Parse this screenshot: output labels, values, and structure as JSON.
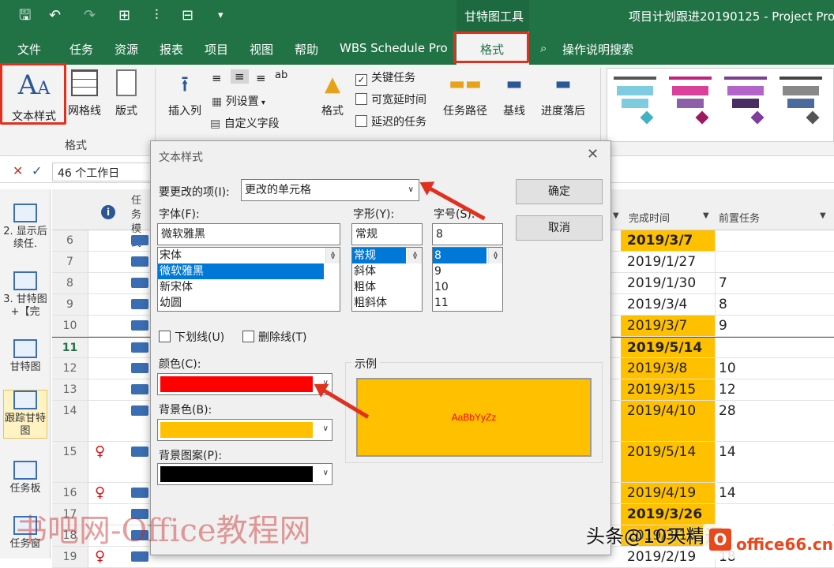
{
  "app": {
    "title": "项目计划跟进20190125 - Project Pro",
    "contextual_tab_group": "甘特图工具"
  },
  "menu": {
    "items": [
      "文件",
      "任务",
      "资源",
      "报表",
      "项目",
      "视图",
      "帮助",
      "WBS Schedule Pro"
    ],
    "active_tab": "格式",
    "search": "操作说明搜索"
  },
  "ribbon": {
    "text_styles": "文本样式",
    "gridlines": "网格线",
    "layout": "版式",
    "group_format": "格式",
    "insert_column": "插入列",
    "column_settings": "列设置",
    "custom_fields": "自定义字段",
    "format": "格式",
    "critical_tasks": "关键任务",
    "slack": "可宽延时间",
    "late_tasks": "延迟的任务",
    "critical_tasks_checked": true,
    "slack_checked": false,
    "late_tasks_checked": false,
    "task_path": "任务路径",
    "baseline": "基线",
    "slippage": "进度落后"
  },
  "formula_bar": {
    "value": "46 个工作日"
  },
  "sidebar": {
    "items": [
      "2. 显示后续任.",
      "3. 甘特图+【完",
      "甘特图",
      "跟踪甘特图",
      "任务板",
      "任务窗"
    ]
  },
  "grid": {
    "headers": {
      "task_mode": "任务模式",
      "finish": "完成时间",
      "predecessors": "前置任务"
    },
    "rows": [
      {
        "id": "6",
        "finish": "2019/3/7",
        "pred": "",
        "hl": true,
        "bold": true
      },
      {
        "id": "7",
        "finish": "2019/1/27",
        "pred": "",
        "hl": false,
        "bold": false
      },
      {
        "id": "8",
        "finish": "2019/1/30",
        "pred": "7",
        "hl": false,
        "bold": false
      },
      {
        "id": "9",
        "finish": "2019/3/4",
        "pred": "8",
        "hl": false,
        "bold": false
      },
      {
        "id": "10",
        "finish": "2019/3/7",
        "pred": "9",
        "hl": true,
        "bold": false
      },
      {
        "id": "11",
        "finish": "2019/5/14",
        "pred": "",
        "hl": true,
        "bold": true
      },
      {
        "id": "12",
        "finish": "2019/3/8",
        "pred": "10",
        "hl": true,
        "bold": false
      },
      {
        "id": "13",
        "finish": "2019/3/15",
        "pred": "12",
        "hl": true,
        "bold": false
      },
      {
        "id": "14",
        "finish": "2019/4/10",
        "pred": "28",
        "hl": true,
        "bold": false
      },
      {
        "id": "15",
        "finish": "2019/5/14",
        "pred": "14",
        "hl": true,
        "bold": false
      },
      {
        "id": "16",
        "finish": "2019/4/19",
        "pred": "14",
        "hl": true,
        "bold": false
      },
      {
        "id": "17",
        "finish": "2019/3/26",
        "pred": "",
        "hl": true,
        "bold": true
      },
      {
        "id": "18",
        "finish": "2019/3/18",
        "pred": "",
        "hl": true,
        "bold": false
      },
      {
        "id": "19",
        "finish": "2019/2/19",
        "pred": "18",
        "hl": false,
        "bold": false
      }
    ]
  },
  "dialog": {
    "title": "文本样式",
    "item_label": "要更改的项(I):",
    "item_value": "更改的单元格",
    "font_label": "字体(F):",
    "font_value": "微软雅黑",
    "font_list": [
      "宋体",
      "微软雅黑",
      "新宋体",
      "幼圆"
    ],
    "style_label": "字形(Y):",
    "style_value": "常规",
    "style_list": [
      "常规",
      "斜体",
      "粗体",
      "粗斜体"
    ],
    "size_label": "字号(S):",
    "size_value": "8",
    "size_list": [
      "8",
      "9",
      "10",
      "11"
    ],
    "ok": "确定",
    "cancel": "取消",
    "underline": "下划线(U)",
    "strikethrough": "删除线(T)",
    "color_label": "颜色(C):",
    "bgcolor_label": "背景色(B):",
    "pattern_label": "背景图案(P):",
    "sample_label": "示例",
    "sample_text": "AaBbYyZz",
    "colors": {
      "text": "#ff0000",
      "background": "#ffc000",
      "pattern": "#000000"
    }
  },
  "watermarks": {
    "left": "书吧网-Office教程网",
    "right": "头条@10天精通",
    "logo": "office66.cn"
  },
  "colors": {
    "accent": "#217346",
    "highlight": "#ffc000",
    "annotation": "#e0301e"
  }
}
